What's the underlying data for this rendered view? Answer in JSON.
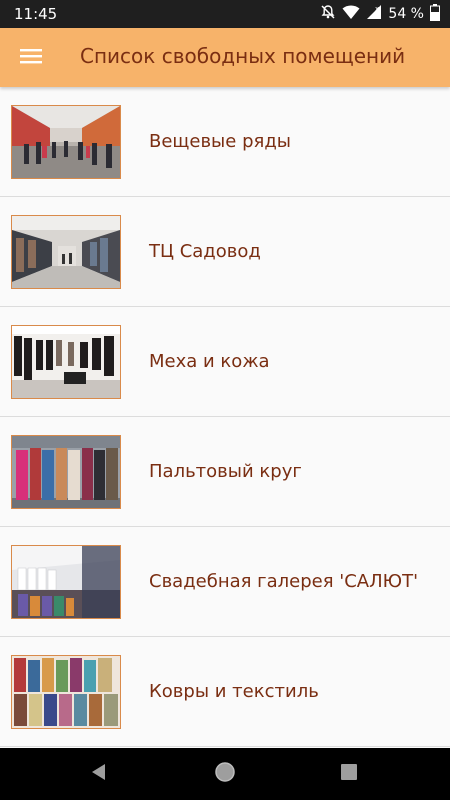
{
  "status_bar": {
    "time": "11:45",
    "battery": "54 %",
    "icons": [
      "notifications-off-icon",
      "wifi-icon",
      "signal-icon",
      "battery-icon"
    ]
  },
  "app_bar": {
    "title": "Список свободных помещений",
    "menu_icon": "hamburger-menu-icon",
    "background": "#f7b36a",
    "title_color": "#7a2e12"
  },
  "list": {
    "items": [
      {
        "label": "Вещевые ряды",
        "image": "market-hall-photo"
      },
      {
        "label": "ТЦ Садовод",
        "image": "mall-corridor-photo"
      },
      {
        "label": "Меха и кожа",
        "image": "fur-leather-shop-photo"
      },
      {
        "label": "Пальтовый круг",
        "image": "coats-rack-photo"
      },
      {
        "label": "Свадебная галерея 'САЛЮТ'",
        "image": "wedding-gallery-photo"
      },
      {
        "label": "Ковры и текстиль",
        "image": "carpet-rolls-photo"
      }
    ]
  },
  "nav_bar": {
    "buttons": [
      "back-icon",
      "home-icon",
      "recents-icon"
    ]
  }
}
